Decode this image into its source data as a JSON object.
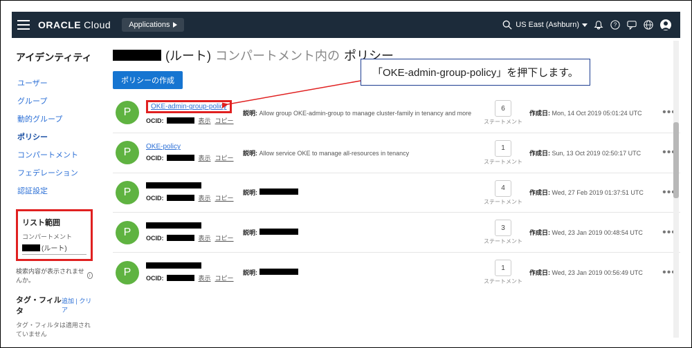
{
  "topbar": {
    "brand_main": "ORACLE",
    "brand_sub": "Cloud",
    "apps_label": "Applications",
    "region": "US East (Ashburn)"
  },
  "sidebar": {
    "title": "アイデンティティ",
    "items": [
      {
        "label": "ユーザー"
      },
      {
        "label": "グループ"
      },
      {
        "label": "動的グループ"
      },
      {
        "label": "ポリシー"
      },
      {
        "label": "コンパートメント"
      },
      {
        "label": "フェデレーション"
      },
      {
        "label": "認証設定"
      }
    ],
    "scope": {
      "title": "リスト範囲",
      "compartment_label": "コンパートメント",
      "root_suffix": "(ルート)"
    },
    "search_note": "検索内容が表示されませんか。",
    "tag_filter_title": "タグ・フィルタ",
    "tag_filter_link": "追加 | クリア",
    "tag_filter_note": "タグ・フィルタは適用されていません"
  },
  "main": {
    "title_root": "(ルート)",
    "title_mid": "コンパートメント内の",
    "title_tail": "ポリシー",
    "create_btn": "ポリシーの作成",
    "labels": {
      "desc": "説明:",
      "ocid": "OCID:",
      "show": "表示",
      "copy": "コピー",
      "statement": "ステートメント",
      "created": "作成日:"
    },
    "rows": [
      {
        "avatar": "P",
        "name": "OKE-admin-group-policy",
        "name_redacted": false,
        "desc": "Allow group OKE-admin-group to manage cluster-family in tenancy and more",
        "desc_redacted": false,
        "count": "6",
        "created": "Mon, 14 Oct 2019 05:01:24 UTC"
      },
      {
        "avatar": "P",
        "name": "OKE-policy",
        "name_redacted": false,
        "desc": "Allow service OKE to manage all-resources in tenancy",
        "desc_redacted": false,
        "count": "1",
        "created": "Sun, 13 Oct 2019 02:50:17 UTC"
      },
      {
        "avatar": "P",
        "name": "",
        "name_redacted": true,
        "desc": "",
        "desc_redacted": true,
        "count": "4",
        "created": "Wed, 27 Feb 2019 01:37:51 UTC"
      },
      {
        "avatar": "P",
        "name": "",
        "name_redacted": true,
        "desc": "",
        "desc_redacted": true,
        "count": "3",
        "created": "Wed, 23 Jan 2019 00:48:54 UTC"
      },
      {
        "avatar": "P",
        "name": "",
        "name_redacted": true,
        "desc": "",
        "desc_redacted": true,
        "count": "1",
        "created": "Wed, 23 Jan 2019 00:56:49 UTC"
      }
    ]
  },
  "callout": "「OKE-admin-group-policy」を押下します。"
}
